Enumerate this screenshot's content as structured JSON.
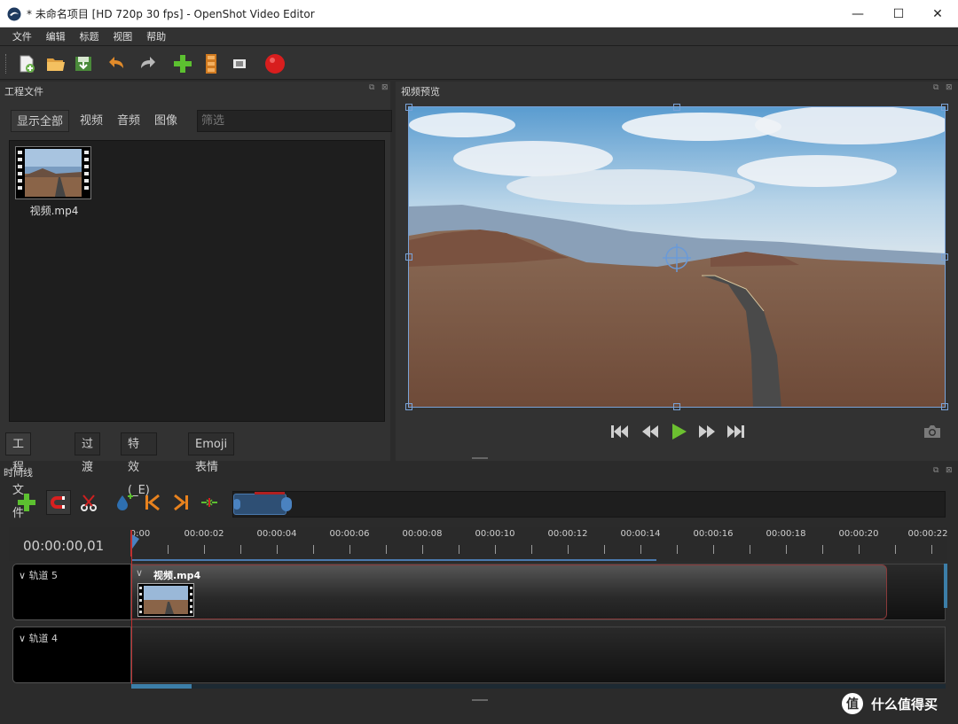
{
  "window": {
    "title": "* 未命名项目 [HD 720p 30 fps] - OpenShot Video Editor",
    "minimize": "—",
    "maximize": "☐",
    "close": "✕"
  },
  "menu": [
    "文件",
    "编辑",
    "标题",
    "视图",
    "帮助"
  ],
  "toolbar": {
    "icons": [
      "new-project-icon",
      "open-project-icon",
      "save-project-icon",
      "undo-icon",
      "redo-icon",
      "import-files-icon",
      "choose-profile-icon",
      "fullscreen-icon",
      "export-video-icon"
    ]
  },
  "project_panel": {
    "title": "工程文件",
    "filters": [
      "显示全部",
      "视频",
      "音频",
      "图像"
    ],
    "filter_placeholder": "筛选",
    "files": [
      {
        "name": "视频.mp4"
      }
    ],
    "tabs": [
      "工程文件",
      "过渡",
      "特效(_E)",
      "Emoji 表情"
    ]
  },
  "preview_panel": {
    "title": "视频预览"
  },
  "timeline": {
    "title": "时间线",
    "time_display": "00:00:00,01",
    "ruler_labels": [
      "0:00",
      "00:00:02",
      "00:00:04",
      "00:00:06",
      "00:00:08",
      "00:00:10",
      "00:00:12",
      "00:00:14",
      "00:00:16",
      "00:00:18",
      "00:00:20",
      "00:00:22"
    ],
    "tracks": [
      {
        "name": "轨道 5",
        "clip": "视频.mp4"
      },
      {
        "name": "轨道 4"
      }
    ]
  },
  "watermark": {
    "mark": "值",
    "text": "什么值得买"
  },
  "colors": {
    "background": "#323232",
    "accent_blue": "#7aa3d8",
    "playhead": "#c03030",
    "clip_border": "#8a3a3a"
  }
}
